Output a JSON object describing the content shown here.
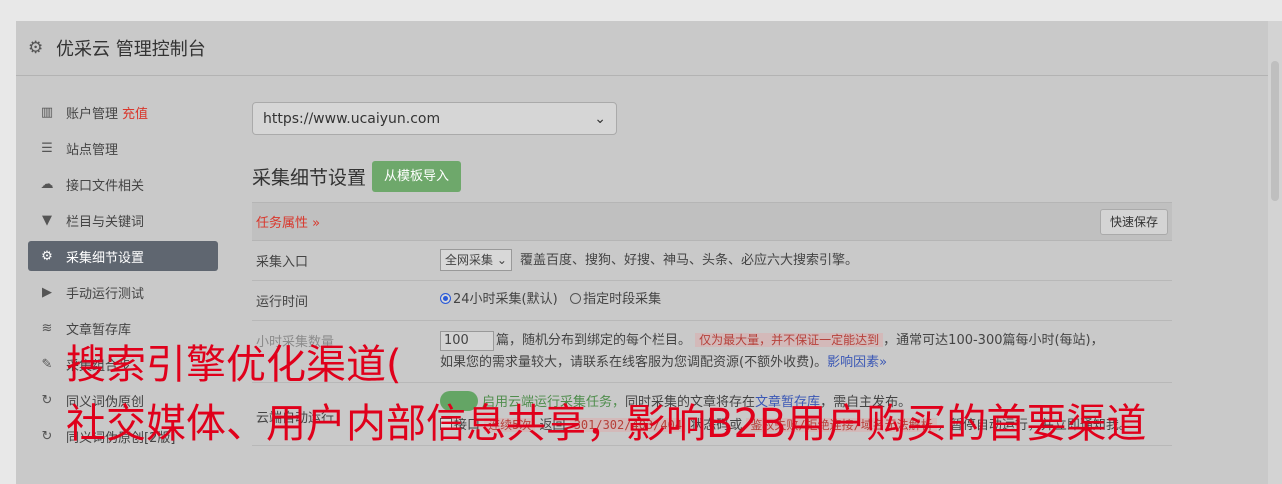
{
  "header": {
    "title": "优采云 管理控制台",
    "icon": "gear-icon"
  },
  "sidebar": {
    "items": [
      {
        "label": "账户管理",
        "extra": "充值",
        "icon": "bar-chart-icon"
      },
      {
        "label": "站点管理",
        "icon": "server-icon"
      },
      {
        "label": "接口文件相关",
        "icon": "cloud-upload-icon"
      },
      {
        "label": "栏目与关键词",
        "icon": "filter-icon"
      },
      {
        "label": "采集细节设置",
        "icon": "gears-icon",
        "active": true
      },
      {
        "label": "手动运行测试",
        "icon": "play-circle-icon"
      },
      {
        "label": "文章暂存库",
        "icon": "database-icon"
      },
      {
        "label": "采集组合步",
        "icon": "edit-icon"
      },
      {
        "label": "同义词伪原创",
        "icon": "refresh-icon"
      },
      {
        "label": "同义词伪原创[2版]",
        "icon": "refresh-icon"
      }
    ]
  },
  "main": {
    "site_select": "https://www.ucaiyun.com",
    "section_title": "采集细节设置",
    "import_button": "从模板导入",
    "panel": {
      "label": "任务属性 »",
      "save_button": "快速保存"
    },
    "rows": {
      "entry": {
        "label": "采集入口",
        "select": "全网采集",
        "desc": "覆盖百度、搜狗、好搜、神马、头条、必应六大搜索引擎。"
      },
      "time": {
        "label": "运行时间",
        "opt1": "24小时采集(默认)",
        "opt2": "指定时段采集"
      },
      "count": {
        "label": "小时采集数量",
        "value": "100",
        "t1": "篇，随机分布到绑定的每个栏目。",
        "hl": "仅为最大量，并不保证一定能达到",
        "t2": "，通常可达100-300篇每小时(每站)，",
        "t3": "如果您的需求量较大，请联系在线客服为您调配资源(不额外收费)。",
        "link": "影响因素»"
      },
      "cloud": {
        "label": "云端自动运行",
        "on_text": "启用云端",
        "t1": "运行采集任务，",
        "t2": "同时采集的文章将存在",
        "link": "文章暂存库",
        "t3": "，需自主发布。",
        "line2a": "接口",
        "hl1": "连续5次",
        "line2b": "返回",
        "hl2": "301/302/403/404",
        "line2c": "状态码或",
        "hl3": "鉴权失败/拒绝连接/域名无法解析",
        "line2d": "，暂停自动运行，并立即通知我。"
      }
    }
  },
  "overlay": {
    "line1": "搜索引擎优化渠道(",
    "line2": "社交媒体、用户内部信息共享，影响B2B用户购买的首要渠道"
  },
  "colors": {
    "overlay_text": "#e0001b",
    "active_item": "#5f6670",
    "import_button": "#6ea86b"
  }
}
